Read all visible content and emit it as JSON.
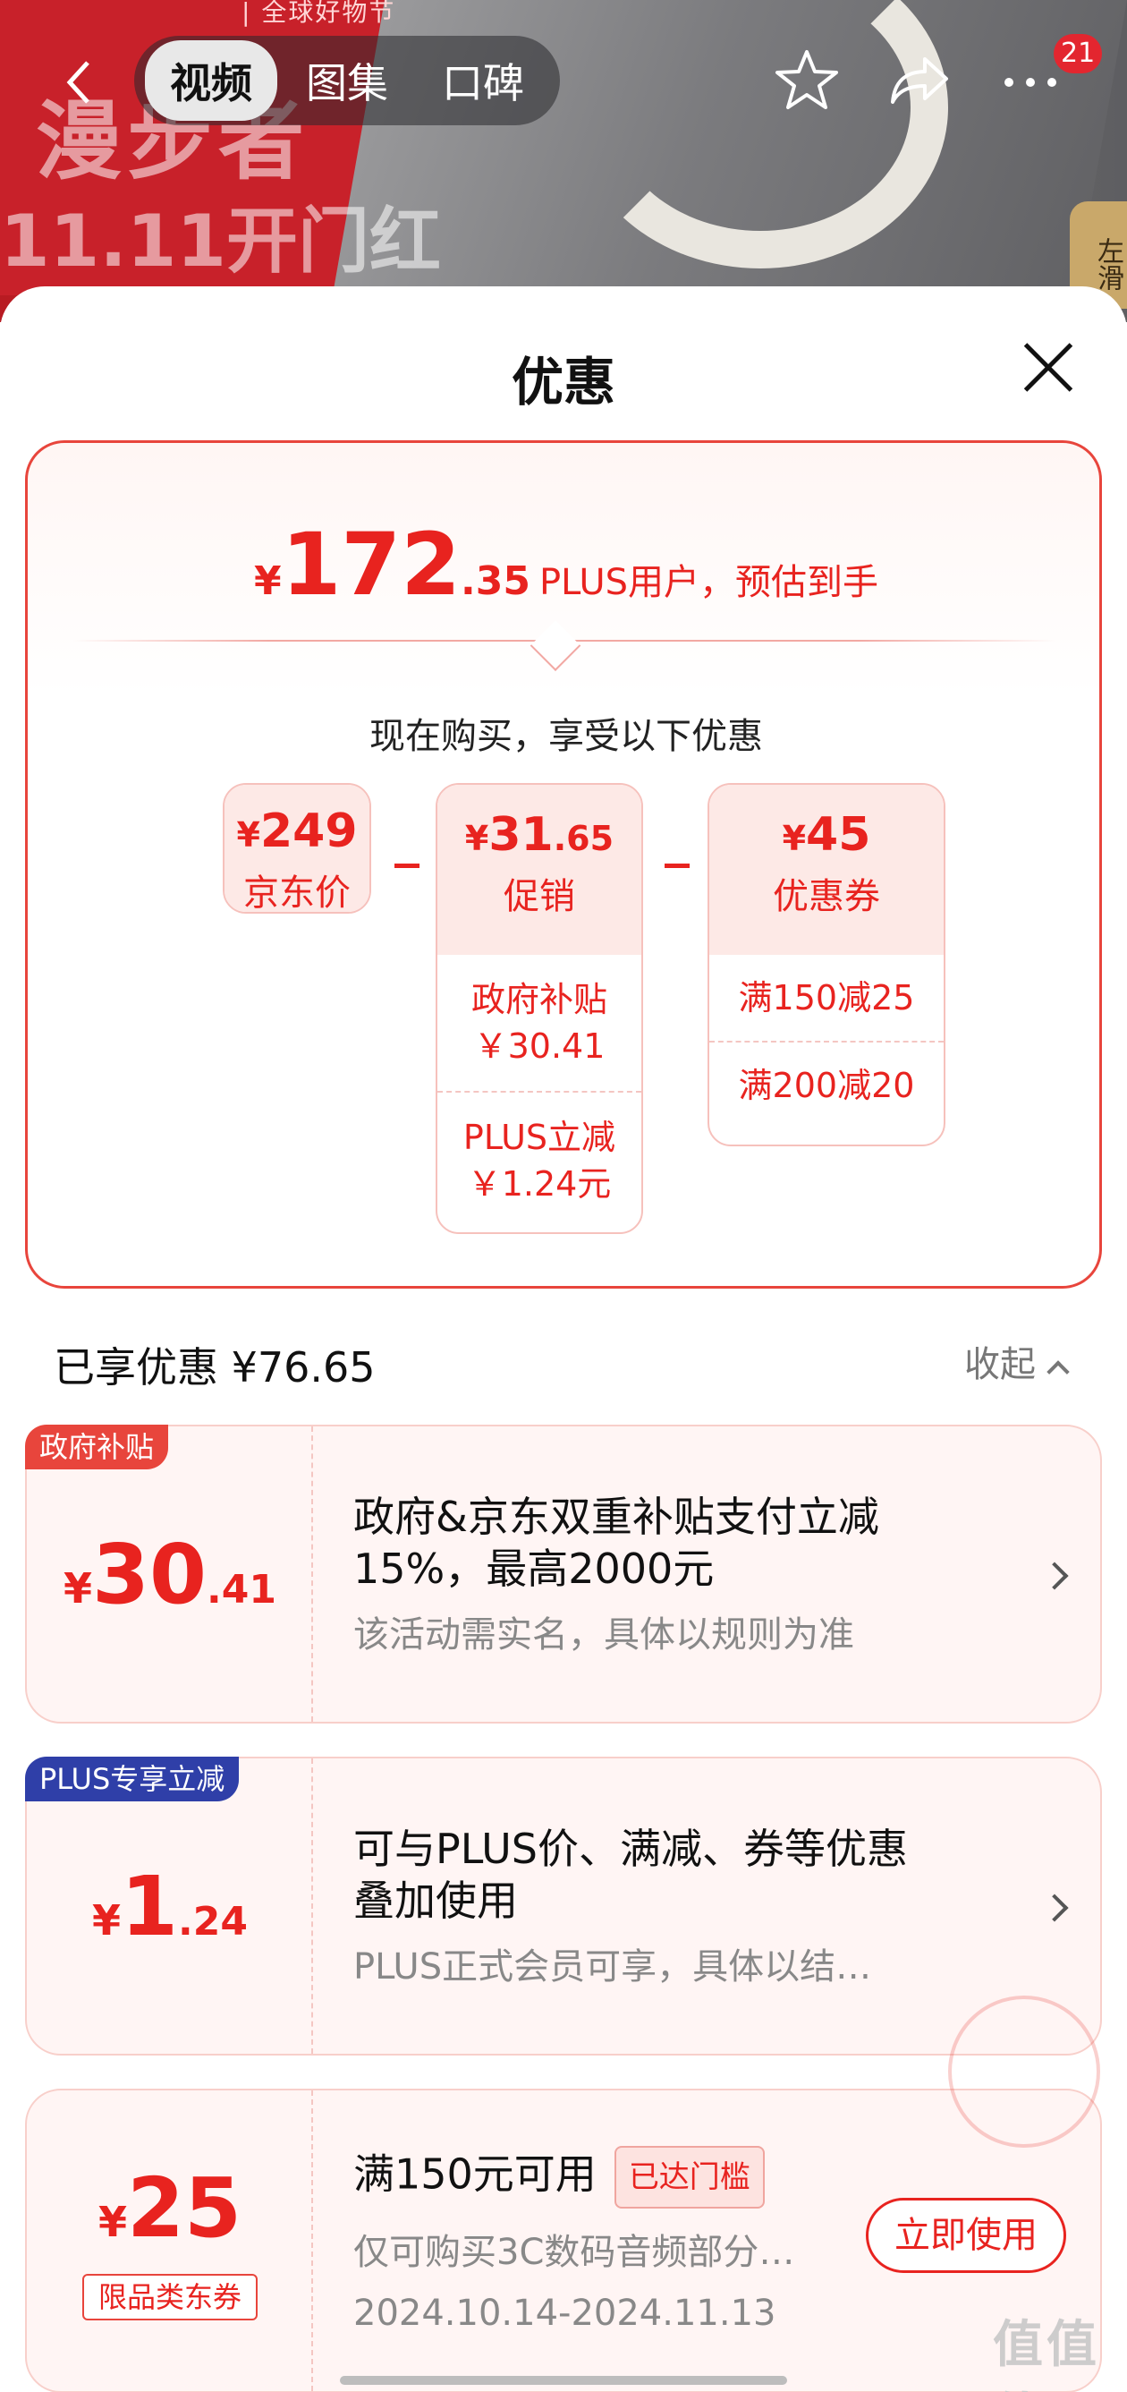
{
  "banner": {
    "slogan_top": "| 全球好物节",
    "slogan_main": "漫步者",
    "slogan_sub": "11.11开门红",
    "tabs": [
      "视频",
      "图集",
      "口碑"
    ],
    "badge_count": "21",
    "side_tab": "左滑"
  },
  "sheet": {
    "title": "优惠"
  },
  "summary": {
    "yen": "¥",
    "price_int": "172",
    "price_dec": ".35",
    "price_desc": "PLUS用户，预估到手",
    "enjoy_text": "现在购买，享受以下优惠",
    "jd_price": {
      "yen": "¥",
      "amount": "249",
      "label": "京东价"
    },
    "promo": {
      "yen": "¥",
      "amount": "31",
      "dec": ".65",
      "label": "促销",
      "items": [
        {
          "line1": "政府补贴",
          "line2": "￥30.41"
        },
        {
          "line1": "PLUS立减",
          "line2": "￥1.24元"
        }
      ]
    },
    "coupon": {
      "yen": "¥",
      "amount": "45",
      "label": "优惠券",
      "items": [
        "满150减25",
        "满200减20"
      ]
    }
  },
  "enjoyed": {
    "label": "已享优惠 ¥76.65",
    "collapse": "收起"
  },
  "cards": [
    {
      "tag": "政府补贴",
      "tag_color": "#e8453c",
      "yen": "¥",
      "int": "30",
      "dec": ".41",
      "title": "政府&京东双重补贴支付立减15%，最高2000元",
      "note": "该活动需实名，具体以规则为准"
    },
    {
      "tag": "PLUS专享立减",
      "tag_color": "#2f3fa8",
      "yen": "¥",
      "int": "1",
      "dec": ".24",
      "title": "可与PLUS价、满减、券等优惠叠加使用",
      "note": "PLUS正式会员可享，具体以结…"
    },
    {
      "yen": "¥",
      "int": "25",
      "limit_tag": "限品类东券",
      "title": "满150元可用",
      "reached": "已达门槛",
      "note": "仅可购买3C数码音频部分…",
      "date": "2024.10.14-2024.11.13",
      "button": "立即使用"
    }
  ],
  "watermark": "值值值",
  "colors": {
    "accent": "#e8231f",
    "plus_blue": "#2f3fa8"
  }
}
